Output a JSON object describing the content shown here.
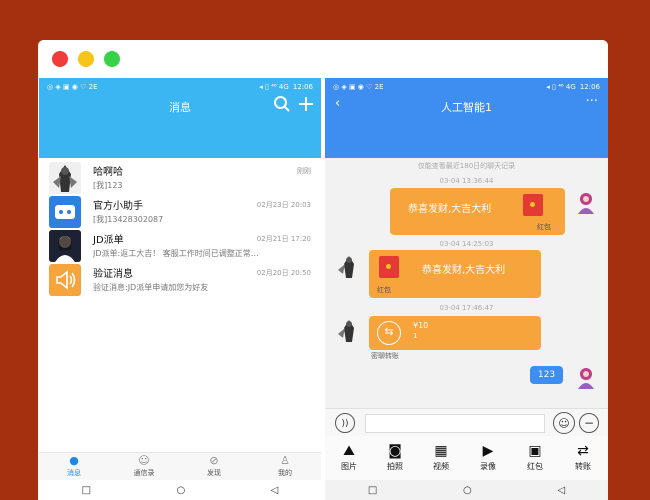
{
  "statusbar": {
    "left_icons": "◎ ◈ ▣ ◉ ♡ 2E",
    "right": "◂ ▯ ⁴⁶ 4G",
    "time": "12:06"
  },
  "left_app": {
    "title": "消息",
    "conversations": [
      {
        "name": "哈啊哈",
        "time": "刚刚",
        "preview": "[我]123"
      },
      {
        "name": "官方小助手",
        "time": "02月23日 20:03",
        "preview": "[我]13428302087"
      },
      {
        "name": "JD派单",
        "time": "02月21日 17:20",
        "preview": "JD派单:返工大吉！ 客服工作时间已调整正常…"
      },
      {
        "name": "验证消息",
        "time": "02月20日 20:50",
        "preview": "验证消息:JD派单申请加您为好友"
      }
    ],
    "tabs": [
      {
        "label": "消息"
      },
      {
        "label": "通信录"
      },
      {
        "label": "发现"
      },
      {
        "label": "我的"
      }
    ]
  },
  "right_app": {
    "title": "人工智能1",
    "notice": "仅能查看最近180日的聊天记录",
    "timestamps": [
      "03-04 13:36:44",
      "03-04 14:25:03",
      "03-04 17:46:47"
    ],
    "msg1": {
      "text": "恭喜发财,大吉大利",
      "label": "红包"
    },
    "msg2": {
      "text": "恭喜发财,大吉大利",
      "label": "红包"
    },
    "msg3": {
      "amount": "¥10",
      "sub": "1",
      "label": "密聊转账"
    },
    "msg4": {
      "text": "123"
    },
    "tools": [
      {
        "label": "图片",
        "icon": "image-icon"
      },
      {
        "label": "拍照",
        "icon": "camera-icon"
      },
      {
        "label": "视频",
        "icon": "video-icon"
      },
      {
        "label": "录像",
        "icon": "record-icon"
      },
      {
        "label": "红包",
        "icon": "red-packet-icon"
      },
      {
        "label": "转账",
        "icon": "transfer-icon"
      }
    ]
  },
  "colors": {
    "left_header": "#3bb6f2",
    "right_header": "#3d8ef0",
    "bubble_orange": "#f7a43c",
    "background": "#a5300f"
  }
}
